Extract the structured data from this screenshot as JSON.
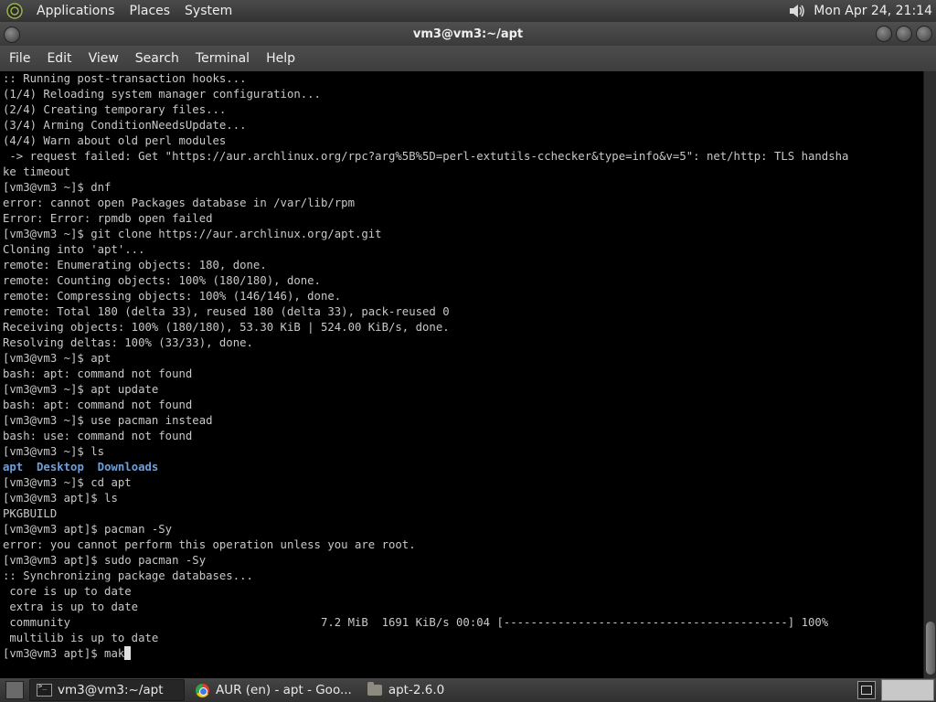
{
  "top_panel": {
    "menus": [
      "Applications",
      "Places",
      "System"
    ],
    "clock": "Mon Apr 24, 21:14"
  },
  "window": {
    "title": "vm3@vm3:~/apt"
  },
  "menubar": {
    "items": [
      "File",
      "Edit",
      "View",
      "Search",
      "Terminal",
      "Help"
    ]
  },
  "terminal": {
    "lines": [
      ":: Running post-transaction hooks...",
      "(1/4) Reloading system manager configuration...",
      "(2/4) Creating temporary files...",
      "(3/4) Arming ConditionNeedsUpdate...",
      "(4/4) Warn about old perl modules",
      " -> request failed: Get \"https://aur.archlinux.org/rpc?arg%5B%5D=perl-extutils-cchecker&type=info&v=5\": net/http: TLS handsha",
      "ke timeout",
      "[vm3@vm3 ~]$ dnf",
      "error: cannot open Packages database in /var/lib/rpm",
      "Error: Error: rpmdb open failed",
      "[vm3@vm3 ~]$ git clone https://aur.archlinux.org/apt.git",
      "Cloning into 'apt'...",
      "remote: Enumerating objects: 180, done.",
      "remote: Counting objects: 100% (180/180), done.",
      "remote: Compressing objects: 100% (146/146), done.",
      "remote: Total 180 (delta 33), reused 180 (delta 33), pack-reused 0",
      "Receiving objects: 100% (180/180), 53.30 KiB | 524.00 KiB/s, done.",
      "Resolving deltas: 100% (33/33), done.",
      "[vm3@vm3 ~]$ apt",
      "bash: apt: command not found",
      "[vm3@vm3 ~]$ apt update",
      "bash: apt: command not found",
      "[vm3@vm3 ~]$ use pacman instead",
      "bash: use: command not found",
      "[vm3@vm3 ~]$ ls"
    ],
    "ls_dirs": [
      "apt",
      "Desktop",
      "Downloads"
    ],
    "lines_after": [
      "[vm3@vm3 ~]$ cd apt",
      "[vm3@vm3 apt]$ ls",
      "PKGBUILD",
      "[vm3@vm3 apt]$ pacman -Sy",
      "error: you cannot perform this operation unless you are root.",
      "[vm3@vm3 apt]$ sudo pacman -Sy",
      ":: Synchronizing package databases...",
      " core is up to date",
      " extra is up to date",
      " community                                     7.2 MiB  1691 KiB/s 00:04 [------------------------------------------] 100%",
      " multilib is up to date"
    ],
    "prompt_current": "[vm3@vm3 apt]$ mak"
  },
  "taskbar": {
    "tasks": [
      {
        "label": "vm3@vm3:~/apt",
        "icon": "terminal-icon",
        "active": true
      },
      {
        "label": "AUR (en) - apt - Goo...",
        "icon": "chrome-icon",
        "active": false
      },
      {
        "label": "apt-2.6.0",
        "icon": "folder-icon",
        "active": false
      }
    ]
  },
  "colors": {
    "terminal_bg": "#000000",
    "terminal_fg": "#c8c8c8",
    "directory": "#6f9fd8"
  }
}
